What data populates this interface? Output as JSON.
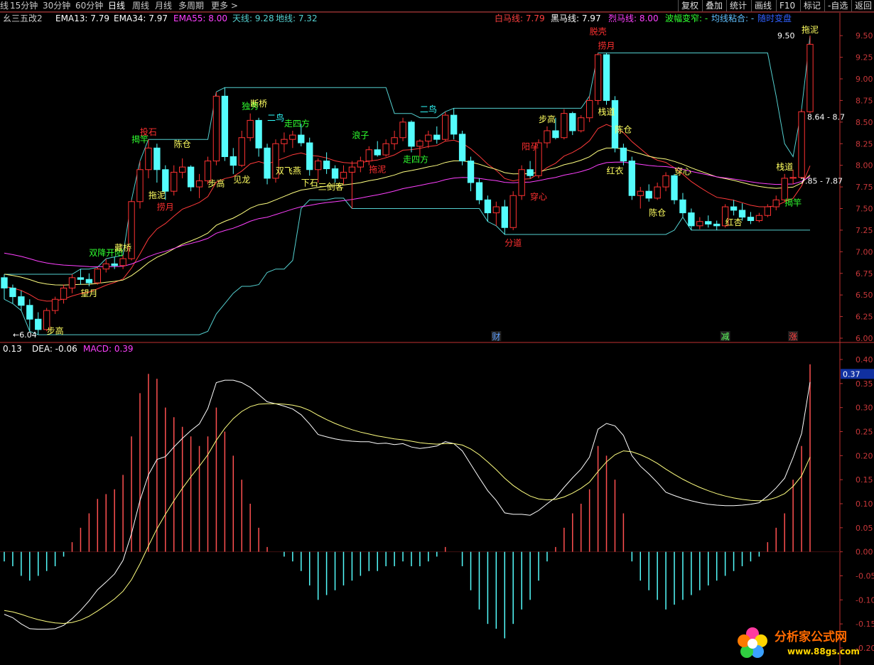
{
  "toolbar": {
    "items": [
      "线",
      "15分钟",
      "30分钟",
      "60分钟",
      "日线",
      "周线",
      "月线",
      "多周期",
      "更多 >"
    ],
    "active_index": 4,
    "right_items": [
      "复权",
      "叠加",
      "统计",
      "画线",
      "F10",
      "标记",
      "-自选",
      "返回"
    ]
  },
  "indicator_legend": {
    "name": "幺三五改2",
    "ema13": "EMA13: 7.79",
    "ema34": "EMA34: 7.97",
    "ema55": "EMA55: 8.00",
    "tianxian": "天线: 9.28",
    "dixian": "地线: 7.32",
    "baima": "白马线: 7.79",
    "heima": "黑马线: 7.97",
    "liema": "烈马线: 8.00",
    "bofu": "波幅变窄: -",
    "junxian": "均线粘合: -",
    "suishi": "随时变盘"
  },
  "macd_legend": {
    "diff": "0.13",
    "dea": "DEA: -0.06",
    "macd": "MACD: 0.39"
  },
  "price_axis": {
    "ticks": [
      "9.50",
      "9.25",
      "9.00",
      "8.75",
      "8.50",
      "8.25",
      "8.00",
      "7.75",
      "7.50",
      "7.25",
      "7.00",
      "6.75",
      "6.50",
      "6.25",
      "6.00"
    ],
    "current_badge": "",
    "high_label": "9.50",
    "low_label": "←6.04",
    "range_labels": [
      "8.64 - 8.7",
      "7.85 - 7.87"
    ]
  },
  "macd_axis": {
    "ticks": [
      "0.40",
      "0.35",
      "0.30",
      "0.25",
      "0.20",
      "0.15",
      "0.10",
      "0.05",
      "0.00",
      "-0.05",
      "-0.10",
      "-0.15",
      "-0.20"
    ],
    "current_badge": "0.37"
  },
  "signals": [
    {
      "text": "投石",
      "color": "#ff3030"
    },
    {
      "text": "拖泥",
      "color": "#ffff60"
    },
    {
      "text": "揭竿",
      "color": "#30ff30"
    },
    {
      "text": "捞月",
      "color": "#ff3030"
    },
    {
      "text": "陈仓",
      "color": "#ffff60"
    },
    {
      "text": "步高",
      "color": "#ffff60"
    },
    {
      "text": "独秀",
      "color": "#30ff30"
    },
    {
      "text": "见龙",
      "color": "#ffff60"
    },
    {
      "text": "二鸟",
      "color": "#30ffff"
    },
    {
      "text": "下石",
      "color": "#ffff60"
    },
    {
      "text": "断桥",
      "color": "#ffff60"
    },
    {
      "text": "双飞燕",
      "color": "#ffff60"
    },
    {
      "text": "走四方",
      "color": "#30ff30"
    },
    {
      "text": "三剑客",
      "color": "#ffff60"
    },
    {
      "text": "浪子",
      "color": "#30ff30"
    },
    {
      "text": "望月",
      "color": "#ffff60"
    },
    {
      "text": "双降开阳",
      "color": "#30ff30"
    },
    {
      "text": "步高",
      "color": "#ffff60"
    },
    {
      "text": "藏桥",
      "color": "#ffff60"
    },
    {
      "text": "拖泥",
      "color": "#ff3030"
    },
    {
      "text": "二鸟",
      "color": "#30ffff"
    },
    {
      "text": "走四方",
      "color": "#30ff30"
    },
    {
      "text": "阳孕",
      "color": "#ff3030"
    },
    {
      "text": "穿心",
      "color": "#ff3030"
    },
    {
      "text": "步高",
      "color": "#ffff60"
    },
    {
      "text": "分道",
      "color": "#ff3030"
    },
    {
      "text": "脱壳",
      "color": "#ff3030"
    },
    {
      "text": "栈道",
      "color": "#ffff60"
    },
    {
      "text": "陈仓",
      "color": "#ffff60"
    },
    {
      "text": "红衣",
      "color": "#ffff60"
    },
    {
      "text": "捞月",
      "color": "#ff3030"
    },
    {
      "text": "陈仓",
      "color": "#ffff60"
    },
    {
      "text": "穿心",
      "color": "#ffff60"
    },
    {
      "text": "红杏",
      "color": "#ffff60"
    },
    {
      "text": "拖泥",
      "color": "#ffff60"
    },
    {
      "text": "揭竿",
      "color": "#30ff30"
    },
    {
      "text": "栈道",
      "color": "#ffff60"
    }
  ],
  "markers": [
    {
      "text": "财",
      "color": "#60a0ff"
    },
    {
      "text": "减",
      "color": "#60ff60"
    },
    {
      "text": "涨",
      "color": "#ff4040"
    }
  ],
  "watermark": {
    "title": "分析家公式网",
    "url": "www.88gs.com"
  },
  "colors": {
    "up": "#ff3232",
    "down": "#54fcfc",
    "ema13": "#ff3a3a",
    "ema34": "#ffff80",
    "ema55": "#ff40ff",
    "tianxian": "#54d0d0",
    "dixian": "#54d0d0",
    "diff": "#ffffff",
    "dea": "#ffff80",
    "bar_pos": "#ff5050",
    "bar_neg": "#54fcfc"
  },
  "chart_data": [
    {
      "type": "candlestick",
      "title": "",
      "ylim": [
        6.0,
        9.6
      ],
      "n": 96,
      "candles": [
        [
          6.7,
          6.74,
          6.45,
          6.58
        ],
        [
          6.58,
          6.62,
          6.4,
          6.48
        ],
        [
          6.48,
          6.55,
          6.32,
          6.38
        ],
        [
          6.38,
          6.45,
          6.08,
          6.22
        ],
        [
          6.22,
          6.3,
          6.04,
          6.1
        ],
        [
          6.1,
          6.35,
          6.08,
          6.32
        ],
        [
          6.32,
          6.48,
          6.28,
          6.45
        ],
        [
          6.45,
          6.62,
          6.4,
          6.58
        ],
        [
          6.58,
          6.74,
          6.52,
          6.7
        ],
        [
          6.7,
          6.8,
          6.62,
          6.68
        ],
        [
          6.68,
          6.75,
          6.6,
          6.64
        ],
        [
          6.64,
          6.82,
          6.62,
          6.8
        ],
        [
          6.8,
          6.92,
          6.76,
          6.86
        ],
        [
          6.86,
          6.94,
          6.8,
          6.84
        ],
        [
          6.84,
          6.96,
          6.8,
          6.92
        ],
        [
          6.92,
          7.6,
          6.9,
          7.58
        ],
        [
          7.58,
          8.05,
          7.5,
          7.95
        ],
        [
          7.95,
          8.3,
          7.85,
          8.2
        ],
        [
          8.2,
          8.25,
          7.8,
          7.95
        ],
        [
          7.95,
          8.0,
          7.6,
          7.7
        ],
        [
          7.7,
          8.0,
          7.65,
          7.92
        ],
        [
          7.92,
          8.08,
          7.85,
          7.98
        ],
        [
          7.98,
          8.0,
          7.7,
          7.75
        ],
        [
          7.75,
          7.9,
          7.62,
          7.82
        ],
        [
          7.82,
          8.1,
          7.78,
          8.05
        ],
        [
          8.05,
          8.85,
          8.0,
          8.8
        ],
        [
          8.8,
          8.9,
          8.05,
          8.1
        ],
        [
          8.1,
          8.2,
          7.9,
          8.0
        ],
        [
          8.0,
          8.4,
          7.98,
          8.32
        ],
        [
          8.32,
          8.6,
          8.28,
          8.52
        ],
        [
          8.52,
          8.55,
          8.1,
          8.2
        ],
        [
          8.2,
          8.25,
          7.78,
          7.85
        ],
        [
          7.85,
          8.3,
          7.8,
          8.25
        ],
        [
          8.25,
          8.38,
          8.15,
          8.3
        ],
        [
          8.3,
          8.4,
          8.2,
          8.35
        ],
        [
          8.35,
          8.48,
          8.22,
          8.26
        ],
        [
          8.26,
          8.32,
          7.88,
          7.95
        ],
        [
          7.95,
          8.08,
          7.8,
          8.05
        ],
        [
          8.05,
          8.15,
          7.9,
          7.96
        ],
        [
          7.96,
          8.0,
          7.8,
          7.85
        ],
        [
          7.85,
          8.0,
          7.78,
          7.92
        ],
        [
          7.92,
          8.05,
          7.5,
          7.98
        ],
        [
          7.98,
          8.1,
          7.92,
          8.05
        ],
        [
          8.05,
          8.22,
          8.0,
          8.18
        ],
        [
          8.18,
          8.28,
          8.1,
          8.12
        ],
        [
          8.12,
          8.3,
          8.1,
          8.25
        ],
        [
          8.25,
          8.4,
          8.18,
          8.32
        ],
        [
          8.32,
          8.55,
          8.28,
          8.5
        ],
        [
          8.5,
          8.52,
          8.15,
          8.22
        ],
        [
          8.22,
          8.3,
          8.1,
          8.28
        ],
        [
          8.28,
          8.4,
          8.2,
          8.35
        ],
        [
          8.35,
          8.45,
          8.25,
          8.3
        ],
        [
          8.3,
          8.62,
          8.28,
          8.58
        ],
        [
          8.58,
          8.66,
          8.3,
          8.36
        ],
        [
          8.36,
          8.4,
          8.0,
          8.05
        ],
        [
          8.05,
          8.1,
          7.7,
          7.8
        ],
        [
          7.8,
          7.85,
          7.55,
          7.6
        ],
        [
          7.6,
          7.65,
          7.35,
          7.45
        ],
        [
          7.45,
          7.58,
          7.3,
          7.52
        ],
        [
          7.52,
          7.6,
          7.2,
          7.28
        ],
        [
          7.28,
          7.7,
          7.25,
          7.65
        ],
        [
          7.65,
          8.0,
          7.6,
          7.95
        ],
        [
          7.95,
          8.05,
          7.85,
          7.88
        ],
        [
          7.88,
          8.3,
          7.85,
          8.26
        ],
        [
          8.26,
          8.45,
          8.2,
          8.4
        ],
        [
          8.4,
          8.55,
          8.3,
          8.32
        ],
        [
          8.32,
          8.65,
          8.3,
          8.6
        ],
        [
          8.6,
          8.62,
          8.35,
          8.4
        ],
        [
          8.4,
          8.58,
          8.38,
          8.55
        ],
        [
          8.55,
          8.8,
          8.5,
          8.75
        ],
        [
          8.75,
          9.3,
          8.7,
          9.28
        ],
        [
          9.28,
          9.3,
          8.7,
          8.75
        ],
        [
          8.75,
          8.8,
          8.15,
          8.2
        ],
        [
          8.2,
          8.25,
          8.0,
          8.05
        ],
        [
          8.05,
          8.1,
          7.6,
          7.65
        ],
        [
          7.65,
          7.75,
          7.5,
          7.7
        ],
        [
          7.7,
          7.78,
          7.58,
          7.62
        ],
        [
          7.62,
          7.8,
          7.6,
          7.75
        ],
        [
          7.75,
          7.92,
          7.7,
          7.88
        ],
        [
          7.88,
          7.9,
          7.55,
          7.6
        ],
        [
          7.6,
          7.68,
          7.4,
          7.45
        ],
        [
          7.45,
          7.5,
          7.25,
          7.3
        ],
        [
          7.3,
          7.4,
          7.26,
          7.35
        ],
        [
          7.35,
          7.42,
          7.28,
          7.32
        ],
        [
          7.32,
          7.36,
          7.25,
          7.3
        ],
        [
          7.3,
          7.55,
          7.28,
          7.52
        ],
        [
          7.52,
          7.6,
          7.42,
          7.48
        ],
        [
          7.48,
          7.56,
          7.36,
          7.4
        ],
        [
          7.4,
          7.46,
          7.32,
          7.36
        ],
        [
          7.36,
          7.45,
          7.34,
          7.42
        ],
        [
          7.42,
          7.55,
          7.4,
          7.52
        ],
        [
          7.52,
          7.65,
          7.48,
          7.6
        ],
        [
          7.6,
          7.9,
          7.58,
          7.85
        ],
        [
          7.85,
          7.95,
          7.78,
          7.86
        ],
        [
          7.86,
          8.65,
          7.84,
          8.62
        ],
        [
          8.62,
          9.5,
          8.6,
          9.4
        ]
      ],
      "ema13_end": 7.79,
      "ema34_end": 7.97,
      "ema55_end": 8.0,
      "tianxian_end": 9.28,
      "dixian_end": 7.32
    },
    {
      "type": "bar+line",
      "title": "MACD",
      "ylim": [
        -0.2,
        0.4
      ],
      "n": 96,
      "macd_bars": [
        -0.02,
        -0.03,
        -0.05,
        -0.06,
        -0.05,
        -0.04,
        -0.03,
        -0.01,
        0.02,
        0.05,
        0.08,
        0.11,
        0.12,
        0.13,
        0.16,
        0.24,
        0.33,
        0.37,
        0.36,
        0.3,
        0.28,
        0.26,
        0.24,
        0.22,
        0.24,
        0.3,
        0.25,
        0.2,
        0.15,
        0.1,
        0.05,
        0.01,
        0.0,
        -0.01,
        -0.02,
        -0.04,
        -0.07,
        -0.1,
        -0.09,
        -0.08,
        -0.07,
        -0.06,
        -0.05,
        -0.04,
        -0.04,
        -0.03,
        -0.03,
        -0.02,
        -0.03,
        -0.03,
        -0.02,
        -0.01,
        0.01,
        0.0,
        -0.03,
        -0.08,
        -0.12,
        -0.15,
        -0.16,
        -0.18,
        -0.15,
        -0.12,
        -0.1,
        -0.06,
        -0.02,
        0.01,
        0.05,
        0.08,
        0.1,
        0.13,
        0.22,
        0.2,
        0.15,
        0.08,
        -0.02,
        -0.06,
        -0.08,
        -0.1,
        -0.12,
        -0.11,
        -0.1,
        -0.09,
        -0.08,
        -0.07,
        -0.06,
        -0.05,
        -0.04,
        -0.03,
        -0.02,
        -0.01,
        0.02,
        0.05,
        0.08,
        0.15,
        0.22,
        0.39
      ],
      "diff_end": 0.13,
      "dea_end": -0.06
    }
  ]
}
